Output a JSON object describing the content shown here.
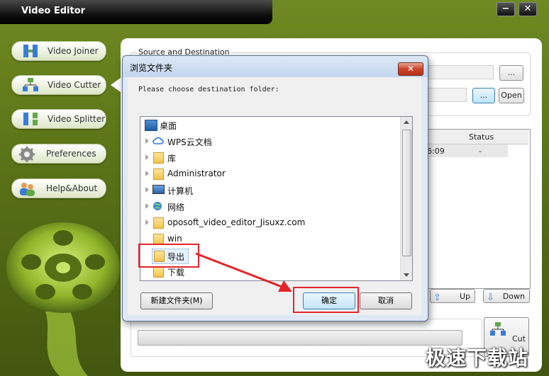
{
  "app": {
    "title": "Video Editor",
    "minimize_glyph": "−",
    "close_glyph": "✕"
  },
  "sidebar": {
    "items": [
      {
        "label": "Video Joiner",
        "icon": "joiner-icon"
      },
      {
        "label": "Video Cutter",
        "icon": "cutter-icon"
      },
      {
        "label": "Video Splitter",
        "icon": "splitter-icon"
      },
      {
        "label": "Preferences",
        "icon": "gear-icon"
      },
      {
        "label": "Help&About",
        "icon": "people-icon"
      }
    ],
    "active": "Video Cutter"
  },
  "main": {
    "source_group_label": "Source and Destination",
    "browse_label_1": "...",
    "browse_label_2": "...",
    "open_label": "Open",
    "table": {
      "status_header": "Status",
      "row_time_fragment": "6:09",
      "row_status": "-"
    },
    "up_label": "Up",
    "down_label": "Down",
    "cut_label": "Cut"
  },
  "dialog": {
    "title": "浏览文件夹",
    "close_glyph": "✕",
    "prompt": "Please choose destination folder:",
    "tree": [
      {
        "label": "桌面",
        "icon": "desktop-icon",
        "expandable": false
      },
      {
        "label": "WPS云文档",
        "icon": "cloud-icon",
        "expandable": true
      },
      {
        "label": "库",
        "icon": "library-icon",
        "expandable": true
      },
      {
        "label": "Administrator",
        "icon": "user-folder-icon",
        "expandable": true
      },
      {
        "label": "计算机",
        "icon": "computer-icon",
        "expandable": true
      },
      {
        "label": "网络",
        "icon": "network-icon",
        "expandable": true
      },
      {
        "label": "oposoft_video_editor_Jisuxz.com",
        "icon": "folder-icon",
        "expandable": true
      },
      {
        "label": "win",
        "icon": "folder-icon",
        "expandable": false
      },
      {
        "label": "导出",
        "icon": "folder-icon",
        "expandable": false
      },
      {
        "label": "下载",
        "icon": "folder-icon",
        "expandable": false
      }
    ],
    "selected": "导出",
    "new_folder_label": "新建文件夹(M)",
    "ok_label": "确定",
    "cancel_label": "取消"
  },
  "watermark": "极速下载站",
  "colors": {
    "app_green": "#6f8a22",
    "annotation_red": "#e1252a",
    "dialog_blue": "#dfe9f5"
  }
}
